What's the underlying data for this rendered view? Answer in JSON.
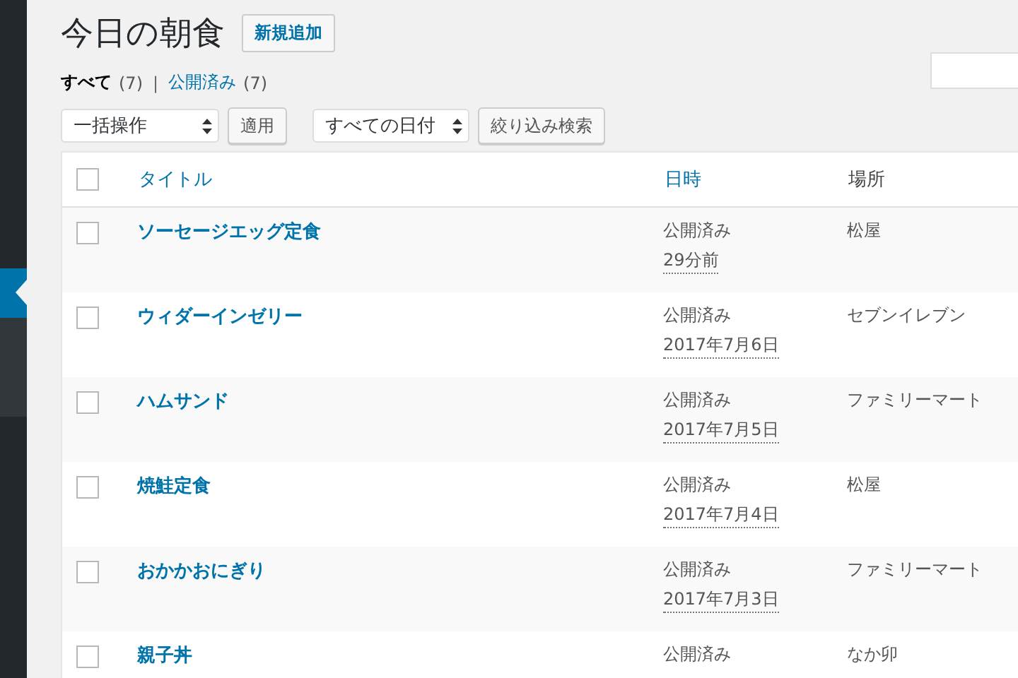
{
  "page_title": "今日の朝食",
  "add_new_button": "新規追加",
  "views": [
    {
      "label": "すべて",
      "count": "(7)",
      "selected": true
    },
    {
      "label": "公開済み",
      "count": "(7)",
      "selected": false
    }
  ],
  "view_separator": "|",
  "bulk_action": {
    "value": "一括操作"
  },
  "apply_button": "適用",
  "date_filter": {
    "value": "すべての日付"
  },
  "filter_button": "絞り込み検索",
  "table": {
    "select_all_checked": false,
    "columns": [
      {
        "label": "タイトル",
        "kind": "link"
      },
      {
        "label": "日時",
        "kind": "link"
      },
      {
        "label": "場所",
        "kind": "plain"
      }
    ],
    "rows": [
      {
        "title": "ソーセージエッグ定食",
        "status": "公開済み",
        "date": "29分前",
        "place": "松屋",
        "checked": false
      },
      {
        "title": "ウィダーインゼリー",
        "status": "公開済み",
        "date": "2017年7月6日",
        "place": "セブンイレブン",
        "checked": false
      },
      {
        "title": "ハムサンド",
        "status": "公開済み",
        "date": "2017年7月5日",
        "place": "ファミリーマート",
        "checked": false
      },
      {
        "title": "焼鮭定食",
        "status": "公開済み",
        "date": "2017年7月4日",
        "place": "松屋",
        "checked": false
      },
      {
        "title": "おかかおにぎり",
        "status": "公開済み",
        "date": "2017年7月3日",
        "place": "ファミリーマート",
        "checked": false
      },
      {
        "title": "親子丼",
        "status": "公開済み",
        "place": "なか卯",
        "checked": false
      }
    ]
  }
}
